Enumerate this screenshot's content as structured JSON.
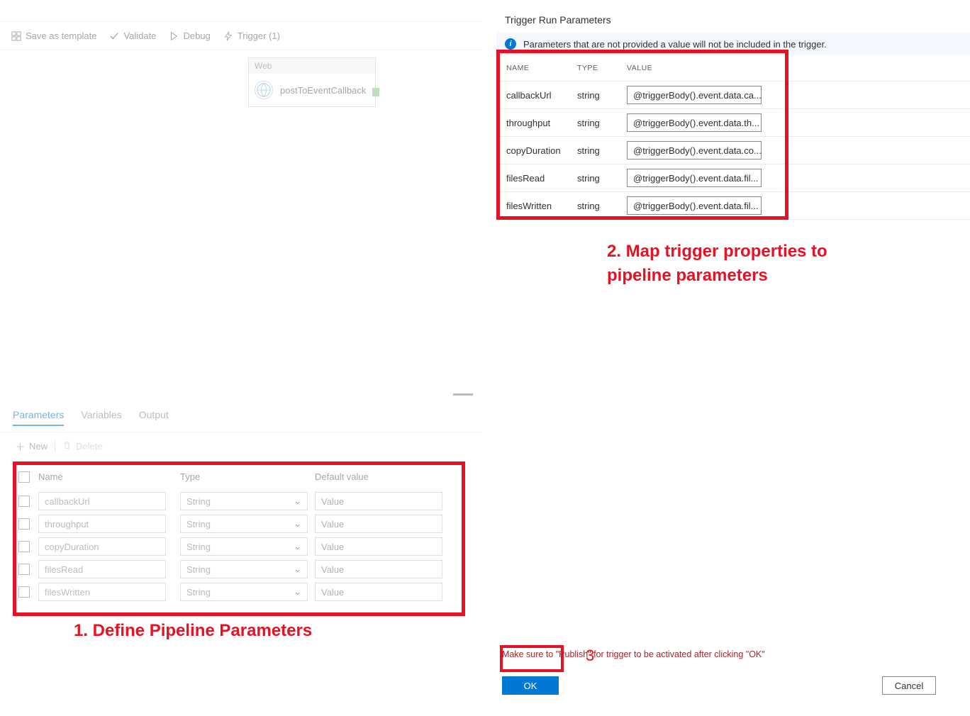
{
  "toolbar": {
    "save_template": "Save as template",
    "validate": "Validate",
    "debug": "Debug",
    "trigger": "Trigger (1)"
  },
  "activity": {
    "type_label": "Web",
    "name": "postToEventCallback"
  },
  "tabs": {
    "parameters": "Parameters",
    "variables": "Variables",
    "output": "Output"
  },
  "param_toolbar": {
    "new": "New",
    "delete": "Delete"
  },
  "param_head": {
    "name": "Name",
    "type": "Type",
    "default": "Default value"
  },
  "param_rows": [
    {
      "name": "callbackUrl",
      "type": "String",
      "placeholder": "Value"
    },
    {
      "name": "throughput",
      "type": "String",
      "placeholder": "Value"
    },
    {
      "name": "copyDuration",
      "type": "String",
      "placeholder": "Value"
    },
    {
      "name": "filesRead",
      "type": "String",
      "placeholder": "Value"
    },
    {
      "name": "filesWritten",
      "type": "String",
      "placeholder": "Value"
    }
  ],
  "panel": {
    "title": "Trigger Run Parameters",
    "info": "Parameters that are not provided a value will not be included in the trigger."
  },
  "trig_head": {
    "name": "NAME",
    "type": "TYPE",
    "value": "VALUE"
  },
  "trig_rows": [
    {
      "name": "callbackUrl",
      "type": "string",
      "value": "@triggerBody().event.data.ca..."
    },
    {
      "name": "throughput",
      "type": "string",
      "value": "@triggerBody().event.data.th..."
    },
    {
      "name": "copyDuration",
      "type": "string",
      "value": "@triggerBody().event.data.co..."
    },
    {
      "name": "filesRead",
      "type": "string",
      "value": "@triggerBody().event.data.fil..."
    },
    {
      "name": "filesWritten",
      "type": "string",
      "value": "@triggerBody().event.data.fil..."
    }
  ],
  "publish_note": "Make sure to \"Publish\" for trigger to be activated after clicking \"OK\"",
  "buttons": {
    "ok": "OK",
    "cancel": "Cancel"
  },
  "annotations": {
    "one": "1. Define Pipeline Parameters",
    "two": "2. Map trigger properties to pipeline parameters",
    "three": "3"
  }
}
